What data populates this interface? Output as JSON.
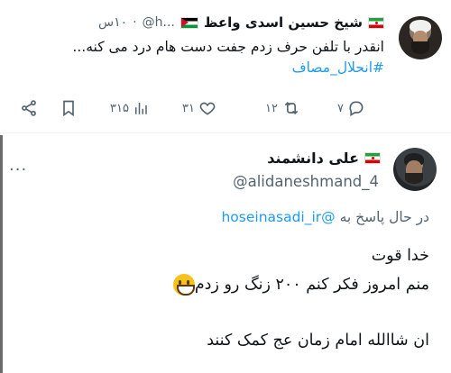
{
  "tweet_top": {
    "author_name": "شیخ حسین اسدی واعظ",
    "handle": "@h...",
    "time": "۱۰س",
    "text": "انقدر با تلفن حرف زدم جفت دست هام درد می کنه...",
    "hashtag": "#انحلال_مصاف",
    "actions": {
      "reply_count": "۷",
      "retweet_count": "۱۲",
      "like_count": "۳۱",
      "views_count": "۳۱۵"
    }
  },
  "tweet_reply": {
    "author_name": "علی دانشمند",
    "handle": "@alidaneshmand_4",
    "more_label": "···",
    "replying_prefix": "در حال پاسخ به",
    "replying_to": "@hoseinasadi_ir",
    "lines": [
      "خدا قوت",
      "منم امروز فکر کنم ۲۰۰ زنگ رو زدم",
      "ان شاالله امام زمان عج کمک کنند"
    ]
  },
  "icons": {
    "reply": "reply-icon",
    "retweet": "retweet-icon",
    "like": "heart-icon",
    "views": "views-icon",
    "bookmark": "bookmark-icon",
    "share": "share-icon"
  },
  "colors": {
    "link": "#1d9bf0",
    "muted": "#536471",
    "text": "#0f1419"
  }
}
